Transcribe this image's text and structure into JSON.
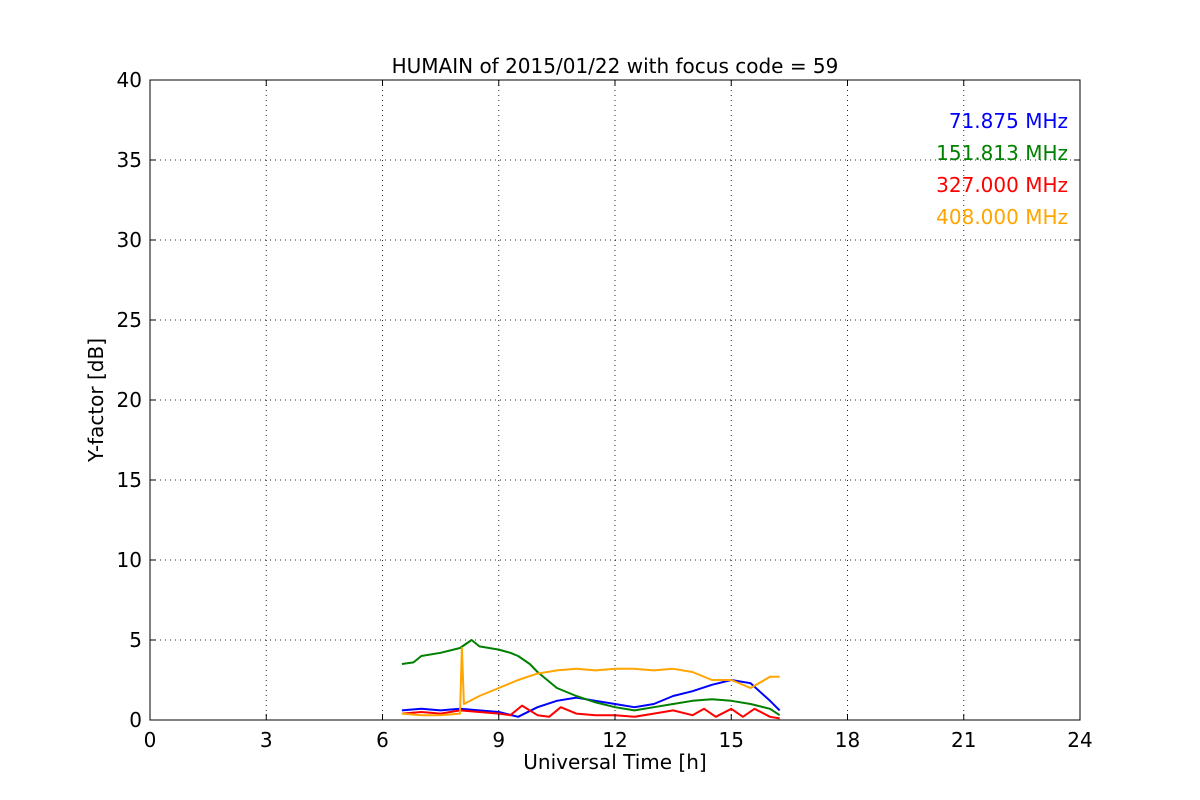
{
  "chart_data": {
    "type": "line",
    "title": "HUMAIN of 2015/01/22 with focus code = 59",
    "xlabel": "Universal Time [h]",
    "ylabel": "Y-factor [dB]",
    "xlim": [
      0,
      24
    ],
    "ylim": [
      0,
      40
    ],
    "xticks": [
      0,
      3,
      6,
      9,
      12,
      15,
      18,
      21,
      24
    ],
    "yticks": [
      0,
      5,
      10,
      15,
      20,
      25,
      30,
      35,
      40
    ],
    "grid": true,
    "legend_placement": "top-right",
    "series": [
      {
        "name": "71.875 MHz",
        "color": "#0000ff",
        "x": [
          6.5,
          7.0,
          7.5,
          8.0,
          8.5,
          9.0,
          9.5,
          10.0,
          10.5,
          11.0,
          11.5,
          12.0,
          12.5,
          13.0,
          13.5,
          14.0,
          14.5,
          15.0,
          15.5,
          16.0,
          16.25
        ],
        "y": [
          0.6,
          0.7,
          0.6,
          0.7,
          0.6,
          0.5,
          0.2,
          0.8,
          1.2,
          1.4,
          1.2,
          1.0,
          0.8,
          1.0,
          1.5,
          1.8,
          2.2,
          2.5,
          2.3,
          1.2,
          0.6
        ]
      },
      {
        "name": "151.813 MHz",
        "color": "#008000",
        "x": [
          6.5,
          6.8,
          7.0,
          7.5,
          8.0,
          8.3,
          8.5,
          9.0,
          9.3,
          9.5,
          9.8,
          10.0,
          10.5,
          11.0,
          11.5,
          12.0,
          12.5,
          13.0,
          13.5,
          14.0,
          14.5,
          15.0,
          15.5,
          16.0,
          16.25
        ],
        "y": [
          3.5,
          3.6,
          4.0,
          4.2,
          4.5,
          5.0,
          4.6,
          4.4,
          4.2,
          4.0,
          3.5,
          3.0,
          2.0,
          1.5,
          1.1,
          0.8,
          0.6,
          0.8,
          1.0,
          1.2,
          1.3,
          1.2,
          1.0,
          0.7,
          0.3
        ]
      },
      {
        "name": "327.000 MHz",
        "color": "#ff0000",
        "x": [
          6.5,
          7.0,
          7.5,
          8.0,
          8.5,
          9.0,
          9.3,
          9.6,
          10.0,
          10.3,
          10.6,
          11.0,
          11.5,
          12.0,
          12.5,
          13.0,
          13.5,
          14.0,
          14.3,
          14.6,
          15.0,
          15.3,
          15.6,
          16.0,
          16.25
        ],
        "y": [
          0.4,
          0.5,
          0.4,
          0.6,
          0.5,
          0.4,
          0.3,
          0.9,
          0.3,
          0.2,
          0.8,
          0.4,
          0.3,
          0.3,
          0.2,
          0.4,
          0.6,
          0.3,
          0.7,
          0.2,
          0.7,
          0.2,
          0.7,
          0.2,
          0.1
        ]
      },
      {
        "name": "408.000 MHz",
        "color": "#ffa500",
        "x": [
          6.5,
          7.0,
          7.5,
          8.0,
          8.05,
          8.1,
          8.5,
          9.0,
          9.5,
          10.0,
          10.5,
          11.0,
          11.5,
          12.0,
          12.5,
          13.0,
          13.5,
          14.0,
          14.5,
          15.0,
          15.5,
          16.0,
          16.25
        ],
        "y": [
          0.4,
          0.3,
          0.3,
          0.4,
          4.5,
          1.0,
          1.5,
          2.0,
          2.5,
          2.9,
          3.1,
          3.2,
          3.1,
          3.2,
          3.2,
          3.1,
          3.2,
          3.0,
          2.5,
          2.5,
          2.0,
          2.7,
          2.7
        ]
      }
    ]
  }
}
